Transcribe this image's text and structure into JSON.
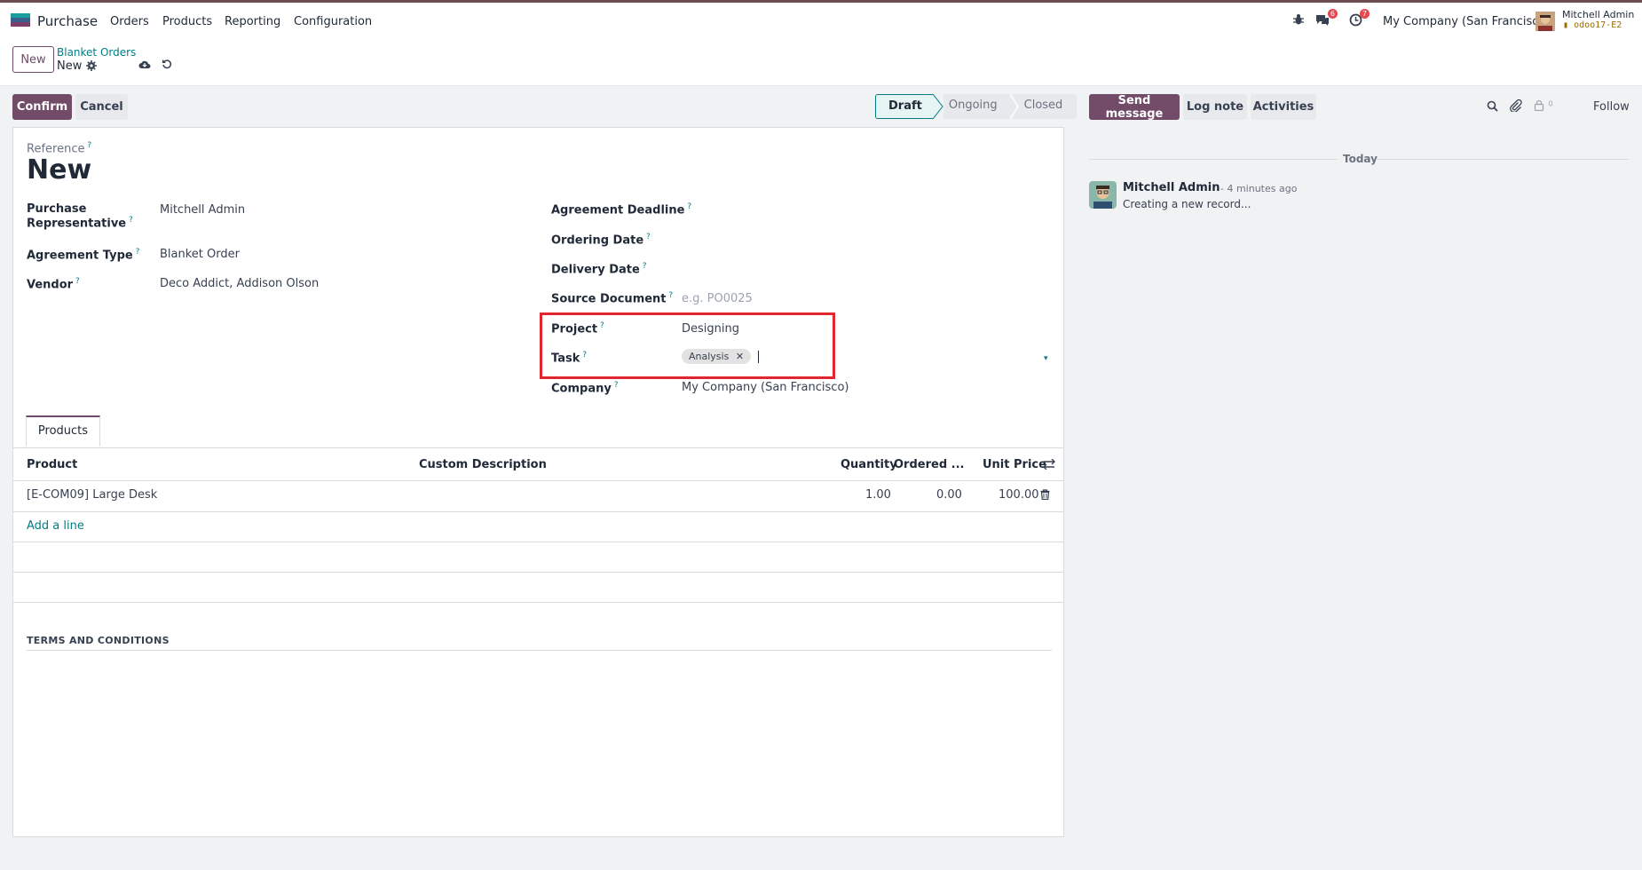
{
  "navbar": {
    "app_name": "Purchase",
    "menu": [
      "Orders",
      "Products",
      "Reporting",
      "Configuration"
    ],
    "messages_count": "6",
    "activities_count": "7",
    "company": "My Company (San Francisco)",
    "user_name": "Mitchell Admin",
    "db_name": "odoo17-E2"
  },
  "control": {
    "new_label": "New",
    "breadcrumb_parent": "Blanket Orders",
    "breadcrumb_current": "New"
  },
  "actions": {
    "confirm_label": "Confirm",
    "cancel_label": "Cancel",
    "statuses": [
      "Draft",
      "Ongoing",
      "Closed"
    ],
    "active_status": "Draft"
  },
  "form": {
    "reference_label": "Reference",
    "reference_value": "New",
    "left_fields": [
      {
        "label": "Purchase Representative",
        "value": "Mitchell Admin"
      },
      {
        "label": "Agreement Type",
        "value": "Blanket Order"
      },
      {
        "label": "Vendor",
        "value": "Deco Addict, Addison Olson"
      }
    ],
    "right_fields": {
      "agreement_deadline": {
        "label": "Agreement Deadline",
        "value": ""
      },
      "ordering_date": {
        "label": "Ordering Date",
        "value": ""
      },
      "delivery_date": {
        "label": "Delivery Date",
        "value": ""
      },
      "source_document": {
        "label": "Source Document",
        "placeholder": "e.g. PO0025"
      },
      "project": {
        "label": "Project",
        "value": "Designing"
      },
      "task": {
        "label": "Task",
        "tag": "Analysis"
      },
      "company": {
        "label": "Company",
        "value": "My Company (San Francisco)"
      }
    },
    "purchase_rep_line1": "Purchase",
    "purchase_rep_line2": "Representative"
  },
  "products_tab": {
    "tab_label": "Products",
    "columns": [
      "Product",
      "Custom Description",
      "Quantity",
      "Ordered ...",
      "Unit Price"
    ],
    "rows": [
      {
        "product": "[E-COM09] Large Desk",
        "custom_description": "",
        "quantity": "1.00",
        "ordered": "0.00",
        "unit_price": "100.00"
      }
    ],
    "add_line_label": "Add a line"
  },
  "terms": {
    "title": "TERMS AND CONDITIONS"
  },
  "chatter": {
    "send_message_label": "Send message",
    "log_note_label": "Log note",
    "activities_label": "Activities",
    "followers_count": "0",
    "follow_label": "Follow",
    "date_separator": "Today",
    "messages": [
      {
        "author": "Mitchell Admin",
        "time": "- 4 minutes ago",
        "body": "Creating a new record..."
      }
    ]
  },
  "colors": {
    "primary": "#714b67",
    "link": "#017e84",
    "highlight_border": "#e0262f"
  }
}
